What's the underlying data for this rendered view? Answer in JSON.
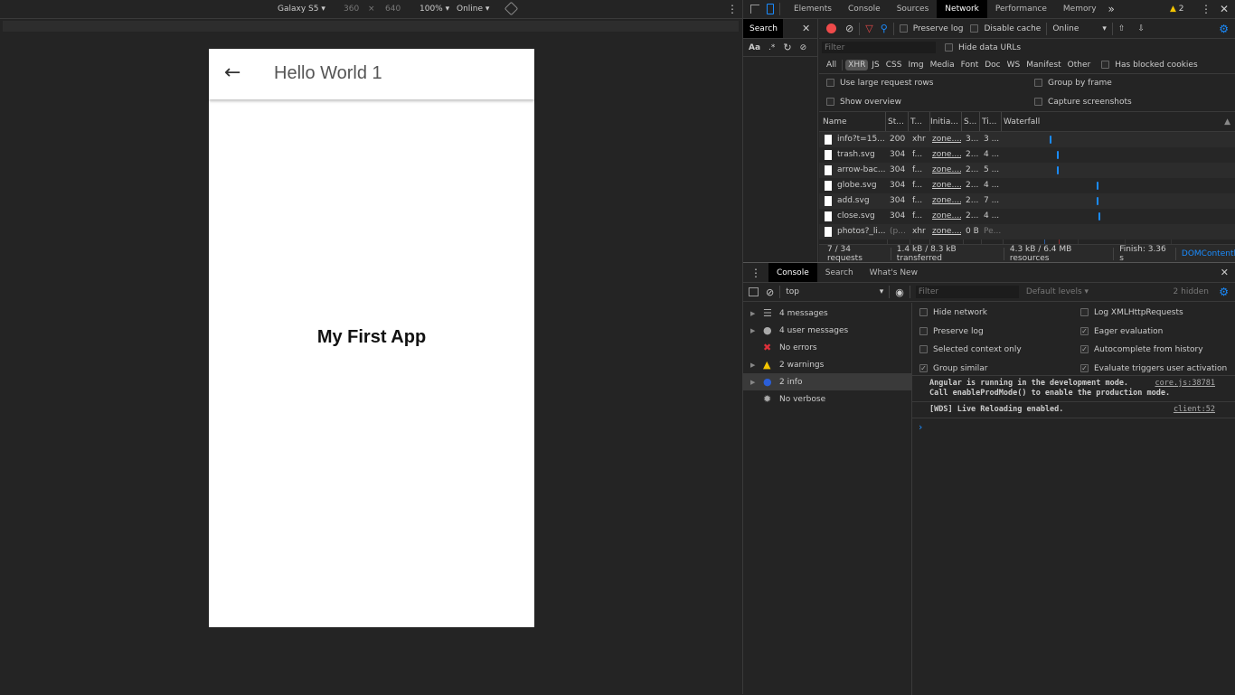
{
  "device_toolbar": {
    "device": "Galaxy S5",
    "width": "360",
    "x": "×",
    "height": "640",
    "zoom": "100%",
    "throttle": "Online"
  },
  "app": {
    "header_title": "Hello World 1",
    "body_text": "My First App"
  },
  "devtools": {
    "tabs": [
      "Elements",
      "Console",
      "Sources",
      "Network",
      "Performance",
      "Memory"
    ],
    "active_tab": "Network",
    "more": "»",
    "warning_count": "2",
    "search_panel": {
      "title": "Search",
      "case_label": "Aa",
      "regex_label": ".*"
    },
    "network": {
      "preserve_log": "Preserve log",
      "disable_cache": "Disable cache",
      "throttle": "Online",
      "filter_placeholder": "Filter",
      "hide_data_urls": "Hide data URLs",
      "types": [
        "All",
        "XHR",
        "JS",
        "CSS",
        "Img",
        "Media",
        "Font",
        "Doc",
        "WS",
        "Manifest",
        "Other"
      ],
      "active_type": "XHR",
      "blocked_cookies": "Has blocked cookies",
      "options": [
        "Use large request rows",
        "Group by frame",
        "Show overview",
        "Capture screenshots"
      ],
      "columns": [
        "Name",
        "St...",
        "T...",
        "Initia...",
        "S...",
        "Ti...",
        "Waterfall"
      ],
      "rows": [
        {
          "name": "info?t=15...",
          "status": "200",
          "type": "xhr",
          "initiator": "zone....",
          "size": "3...",
          "time": "3 ...",
          "wf": 0.2
        },
        {
          "name": "trash.svg",
          "status": "304",
          "type": "f...",
          "initiator": "zone....",
          "size": "2...",
          "time": "4 ...",
          "wf": 0.23
        },
        {
          "name": "arrow-bac...",
          "status": "304",
          "type": "f...",
          "initiator": "zone....",
          "size": "2...",
          "time": "5 ...",
          "wf": 0.23
        },
        {
          "name": "globe.svg",
          "status": "304",
          "type": "f...",
          "initiator": "zone....",
          "size": "2...",
          "time": "4 ...",
          "wf": 0.4
        },
        {
          "name": "add.svg",
          "status": "304",
          "type": "f...",
          "initiator": "zone....",
          "size": "2...",
          "time": "7 ...",
          "wf": 0.4
        },
        {
          "name": "close.svg",
          "status": "304",
          "type": "f...",
          "initiator": "zone....",
          "size": "2...",
          "time": "4 ...",
          "wf": 0.41
        },
        {
          "name": "photos?_li...",
          "status": "(p...",
          "type": "xhr",
          "initiator": "zone....",
          "size": "0 B",
          "time": "Pe...",
          "wf": null
        }
      ],
      "status": [
        "7 / 34 requests",
        "1.4 kB / 8.3 kB transferred",
        "4.3 kB / 6.4 MB resources",
        "Finish: 3.36 s",
        "DOMContentl"
      ]
    },
    "drawer": {
      "tabs": [
        "Console",
        "Search",
        "What's New"
      ],
      "context": "top",
      "filter_placeholder": "Filter",
      "levels": "Default levels",
      "hidden": "2 hidden",
      "sidebar": [
        {
          "label": "4 messages",
          "icon": "list-icon",
          "color": "#aaaaaa"
        },
        {
          "label": "4 user messages",
          "icon": "user-icon",
          "color": "#aaaaaa"
        },
        {
          "label": "No errors",
          "icon": "error-icon",
          "color": "#e0303a"
        },
        {
          "label": "2 warnings",
          "icon": "warning-icon",
          "color": "#f4c500"
        },
        {
          "label": "2 info",
          "icon": "info-icon",
          "color": "#2b5fd9"
        },
        {
          "label": "No verbose",
          "icon": "bug-icon",
          "color": "#aaaaaa"
        }
      ],
      "settings": [
        {
          "label": "Hide network",
          "checked": false
        },
        {
          "label": "Log XMLHttpRequests",
          "checked": false
        },
        {
          "label": "Preserve log",
          "checked": false
        },
        {
          "label": "Eager evaluation",
          "checked": true
        },
        {
          "label": "Selected context only",
          "checked": false
        },
        {
          "label": "Autocomplete from history",
          "checked": true
        },
        {
          "label": "Group similar",
          "checked": true
        },
        {
          "label": "Evaluate triggers user activation",
          "checked": true
        }
      ],
      "messages": [
        {
          "lines": [
            "Angular is running in the development mode.",
            "Call enableProdMode() to enable the production mode."
          ],
          "source": "core.js:38781"
        },
        {
          "lines": [
            "[WDS] Live Reloading enabled."
          ],
          "source": "client:52"
        }
      ],
      "prompt": "›"
    }
  },
  "colors": {
    "accent": "#1a8cff",
    "record": "#ef4a4a",
    "filter": "#e84a4a"
  }
}
